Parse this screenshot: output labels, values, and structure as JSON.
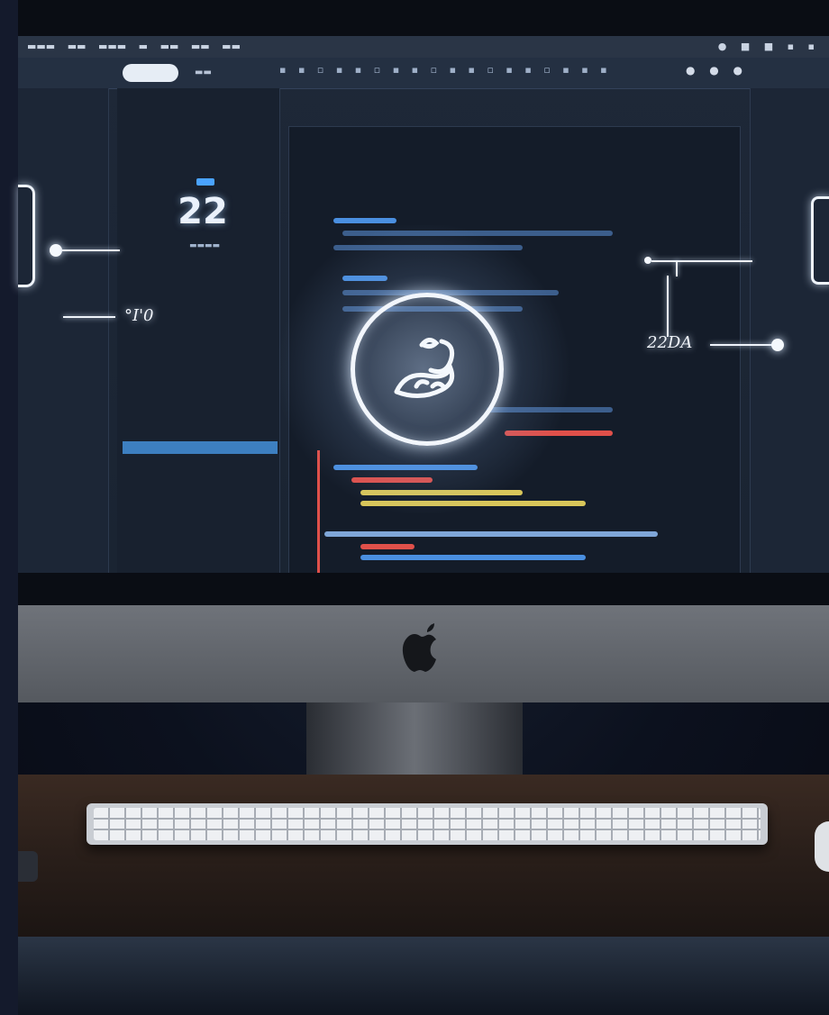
{
  "screen": {
    "big_number": "22",
    "callout_left_label": "°I'0",
    "callout_right_label": "22DA"
  },
  "icons": {
    "brand_logo": "apple-logo-icon",
    "center_logo": "circular-glyph-logo-icon",
    "left_doc": "document-icon",
    "right_doc": "document-icon"
  },
  "colors": {
    "glow": "#f2f6fc",
    "accent_blue": "#3d7fc0",
    "code_yellow": "#d9c65a",
    "code_blue": "#4a8fe0",
    "code_red": "#e0504a"
  }
}
